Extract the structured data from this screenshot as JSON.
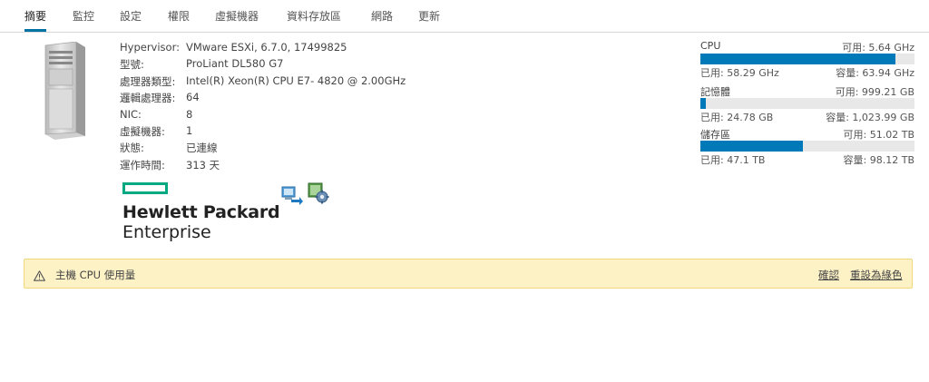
{
  "tabs": [
    {
      "label": "摘要",
      "active": true
    },
    {
      "label": "監控"
    },
    {
      "label": "設定"
    },
    {
      "label": "權限"
    },
    {
      "label": "虛擬機器"
    },
    {
      "label": "資料存放區"
    },
    {
      "label": "網路"
    },
    {
      "label": "更新"
    }
  ],
  "host_info": [
    {
      "label": "Hypervisor:",
      "value": "VMware ESXi, 6.7.0, 17499825"
    },
    {
      "label": "型號:",
      "value": "ProLiant DL580 G7"
    },
    {
      "label": "處理器類型:",
      "value": "Intel(R) Xeon(R) CPU E7- 4820 @ 2.00GHz"
    },
    {
      "label": "邏輯處理器:",
      "value": "64"
    },
    {
      "label": "NIC:",
      "value": "8"
    },
    {
      "label": "虛擬機器:",
      "value": "1"
    },
    {
      "label": "狀態:",
      "value": "已連線"
    },
    {
      "label": "運作時間:",
      "value": "313 天"
    }
  ],
  "vendor_logo": {
    "line1": "Hewlett Packard",
    "line2": "Enterprise",
    "color": "#01a982"
  },
  "actions": [
    "migrate-vm-icon",
    "host-settings-icon"
  ],
  "resources": [
    {
      "name": "CPU",
      "free": "可用: 5.64 GHz",
      "used": "已用: 58.29 GHz",
      "capacity": "容量: 63.94 GHz",
      "usage_fraction": 0.912
    },
    {
      "name": "記憶體",
      "free": "可用: 999.21 GB",
      "used": "已用: 24.78 GB",
      "capacity": "容量: 1,023.99 GB",
      "usage_fraction": 0.024
    },
    {
      "name": "儲存區",
      "free": "可用: 51.02 TB",
      "used": "已用: 47.1 TB",
      "capacity": "容量: 98.12 TB",
      "usage_fraction": 0.48
    }
  ],
  "alert": {
    "text": "主機 CPU 使用量",
    "acknowledge": "確認",
    "reset": "重設為綠色",
    "icon": "warning-icon",
    "color": "#fdf2c6"
  },
  "colors": {
    "accent": "#0079b8",
    "tab_active": "#0072a3"
  }
}
